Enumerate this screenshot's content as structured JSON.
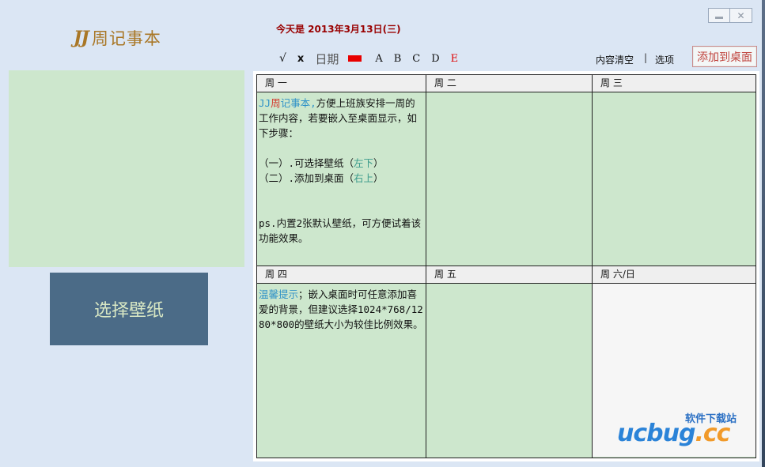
{
  "app": {
    "logo_mark": "JJ",
    "logo_name": "周记事本",
    "window_buttons": {
      "minimize_icon": "minimize-icon",
      "close": "✕"
    }
  },
  "header": {
    "date_text": "今天是  2013年3月13日(三)"
  },
  "toolbar": {
    "check": "√",
    "cross": "x",
    "date": "日期",
    "red_marker_color": "#e80000",
    "letters": [
      "A",
      "B",
      "C",
      "D",
      "E"
    ],
    "clear_content": "内容清空",
    "separator": "|",
    "options": "选项",
    "add_to_desktop": "添加到桌面"
  },
  "left_panel": {
    "choose_wallpaper": "选择壁纸"
  },
  "week_grid": {
    "days": [
      "周 一",
      "周 二",
      "周 三",
      "周 四",
      "周 五",
      "周 六/日"
    ],
    "monday_note": {
      "brand_jj": "JJ",
      "brand_zhou": "周",
      "brand_rest": "记事本,",
      "line1_rest": "方便上班族安排一周的工作内容，若要嵌入至桌面显示，如下步骤：",
      "step1_prefix": "（一）.可选择壁纸（",
      "step1_hint": "左下",
      "step1_suffix": "）",
      "step2_prefix": "（二）.添加到桌面（",
      "step2_hint": "右上",
      "step2_suffix": "）",
      "ps": "ps.内置2张默认壁纸，可方便试着该功能效果。"
    },
    "thursday_note": {
      "tip_label": "温馨提示",
      "tip_text": "；嵌入桌面时可任意添加喜爱的背景，但建议选择1024*768/1280*800的壁纸大小为较佳比例效果。"
    }
  },
  "watermark": {
    "top": "软件下载站",
    "main_pre": "ucbug",
    "main_post": ".cc"
  },
  "colors": {
    "background": "#dbe6f4",
    "cell_green": "#cde7cd",
    "wallpaper_button": "#4b6b87",
    "date_red": "#990000",
    "accent_blue": "#2f92c8"
  }
}
